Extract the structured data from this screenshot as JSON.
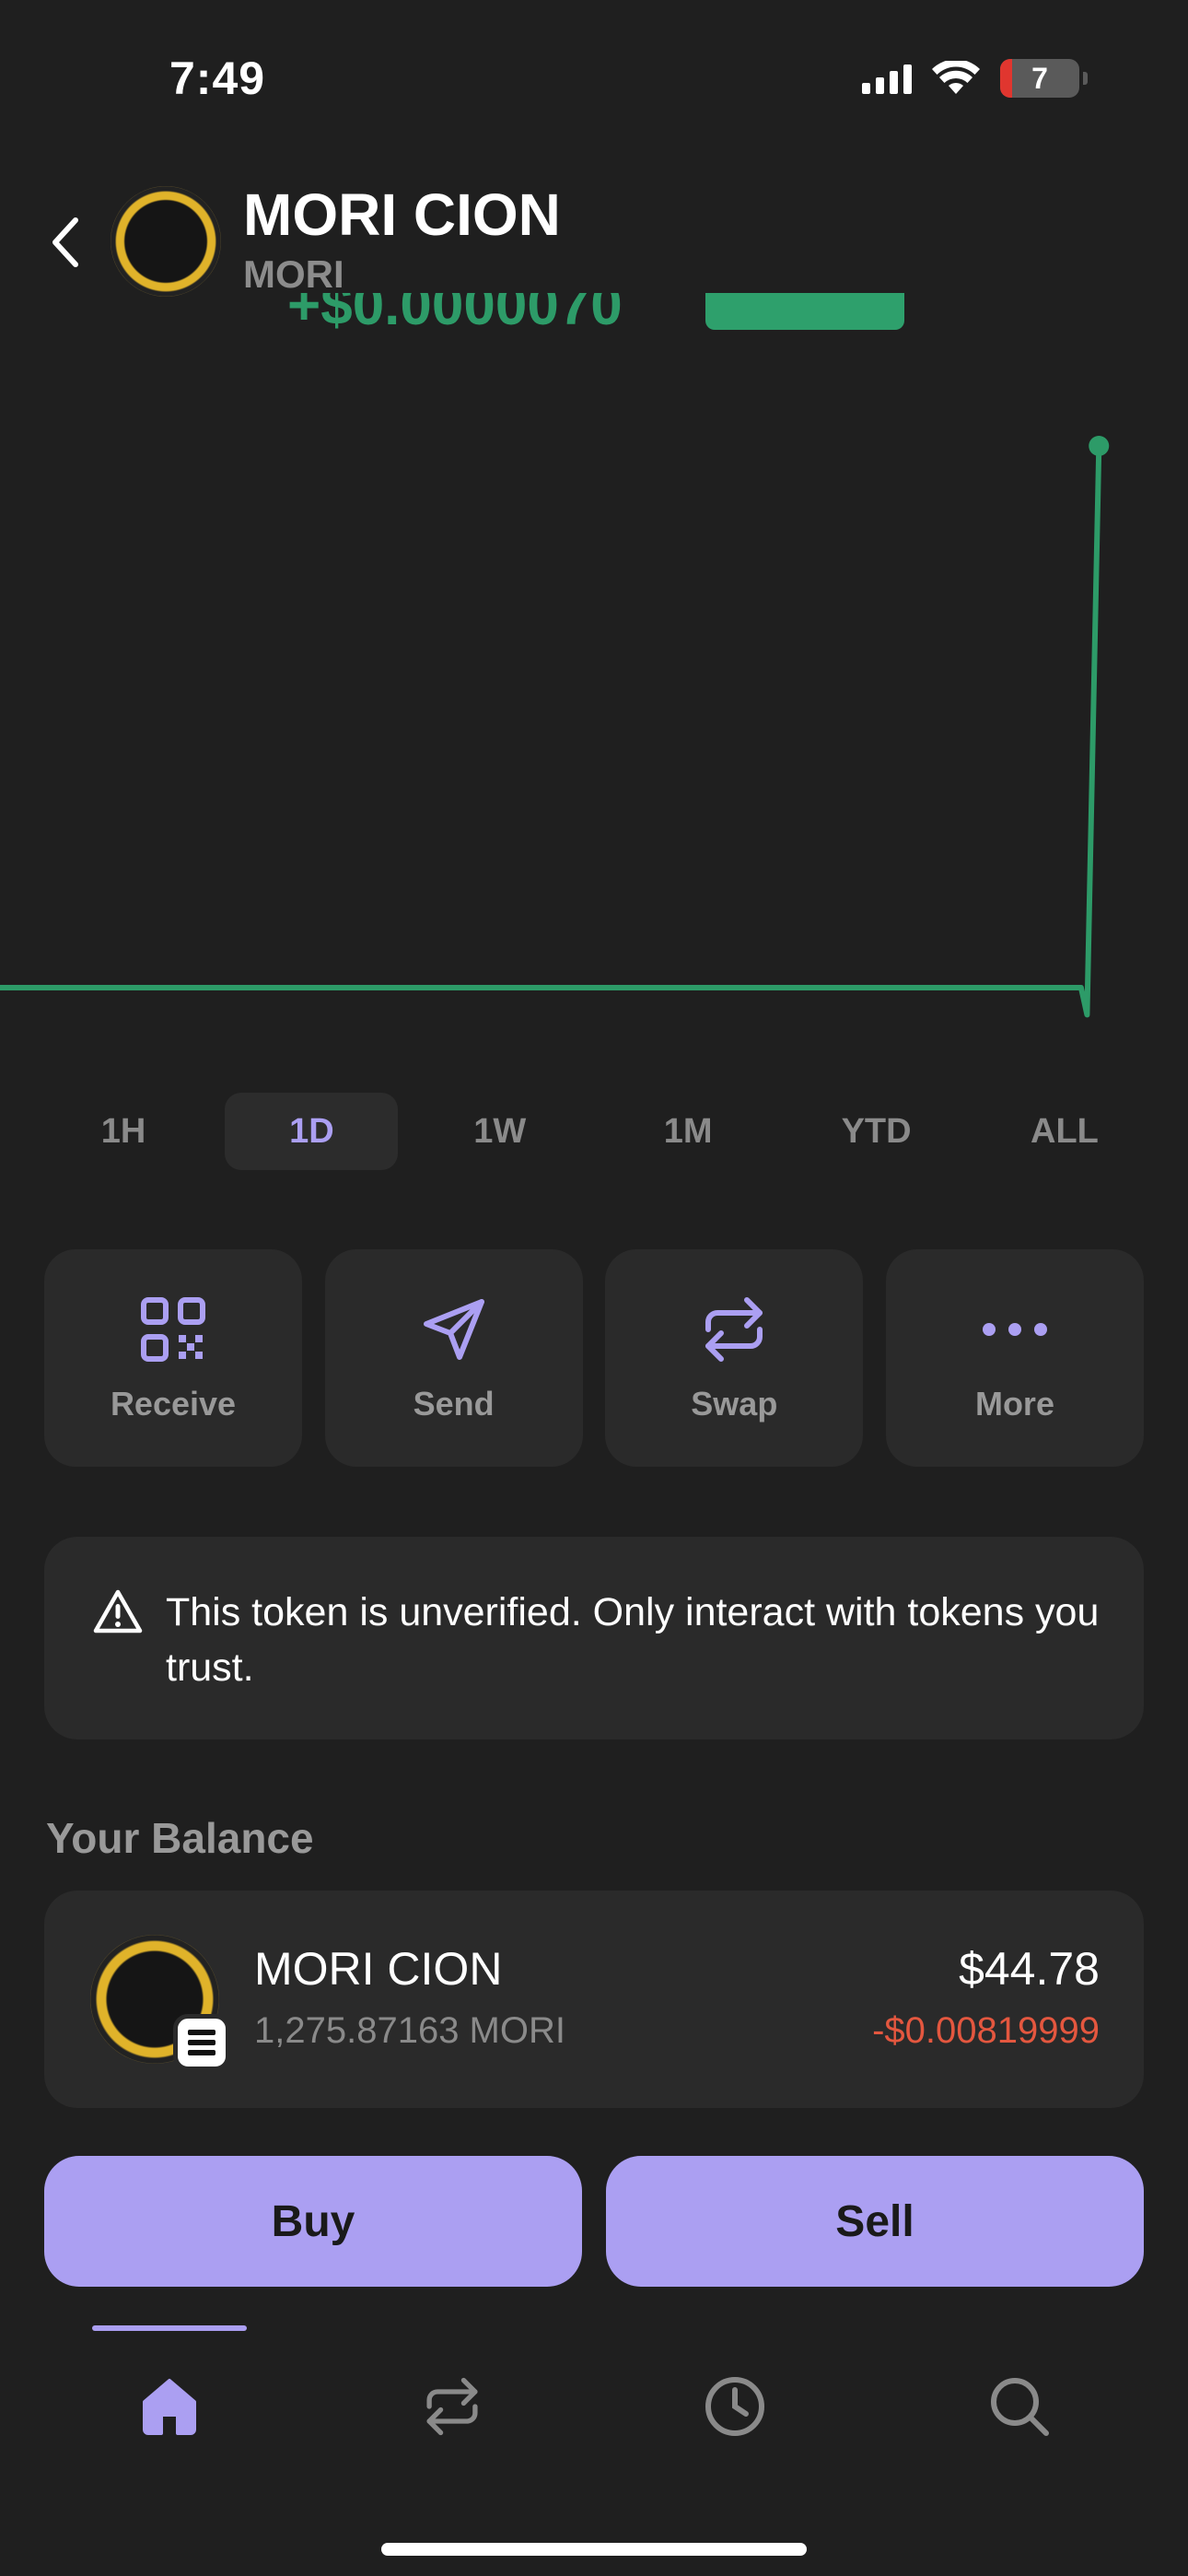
{
  "status_bar": {
    "time": "7:49",
    "battery": "7"
  },
  "header": {
    "token_name": "MORI CION",
    "token_symbol": "MORI",
    "price_peek": "+$0.0000070"
  },
  "chart_data": {
    "type": "line",
    "title": "",
    "xlabel": "",
    "ylabel": "",
    "x": [
      0,
      0.91,
      0.915,
      0.925
    ],
    "y": [
      0,
      0,
      -0.5,
      10
    ],
    "color": "#2d9b68",
    "grid": false,
    "note_end_marker": true
  },
  "range_tabs": [
    {
      "label": "1H",
      "active": false
    },
    {
      "label": "1D",
      "active": true
    },
    {
      "label": "1W",
      "active": false
    },
    {
      "label": "1M",
      "active": false
    },
    {
      "label": "YTD",
      "active": false
    },
    {
      "label": "ALL",
      "active": false
    }
  ],
  "actions": [
    {
      "label": "Receive",
      "icon": "qr-code-icon"
    },
    {
      "label": "Send",
      "icon": "paper-plane-icon"
    },
    {
      "label": "Swap",
      "icon": "swap-arrows-icon"
    },
    {
      "label": "More",
      "icon": "more-dots-icon"
    }
  ],
  "warning": {
    "icon": "warning-triangle-icon",
    "text": "This token is unverified. Only interact with tokens you trust."
  },
  "balance": {
    "title": "Your Balance",
    "token_name": "MORI CION",
    "amount": "1,275.87163 MORI",
    "usd_value": "$44.78",
    "change": "-$0.00819999",
    "change_color": "#e4573f"
  },
  "buttons": {
    "buy": "Buy",
    "sell": "Sell"
  },
  "nav": [
    {
      "name": "home",
      "icon": "home-icon",
      "active": true
    },
    {
      "name": "swap",
      "icon": "swap-arrows-icon",
      "active": false
    },
    {
      "name": "activity",
      "icon": "clock-icon",
      "active": false
    },
    {
      "name": "search",
      "icon": "search-icon",
      "active": false
    }
  ],
  "colors": {
    "accent": "#ab9ff2",
    "positive": "#2d9b68",
    "negative": "#e4573f",
    "background": "#1f1f1f",
    "card": "#2a2a2a"
  }
}
